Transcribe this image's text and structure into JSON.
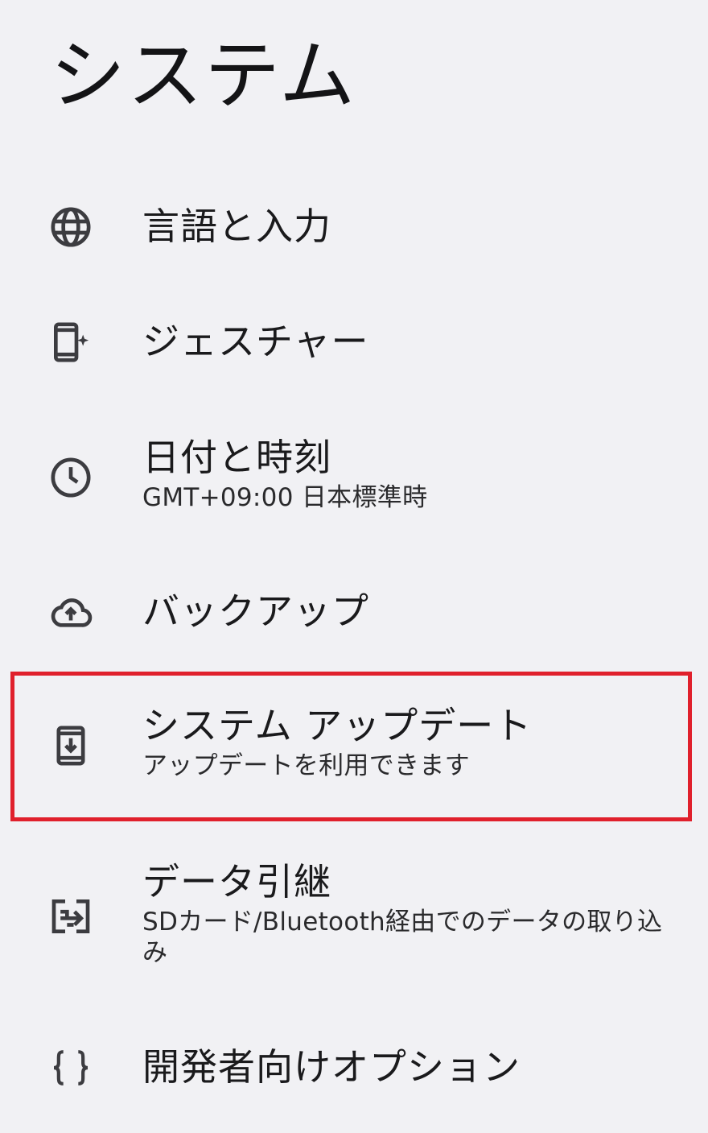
{
  "header": {
    "title": "システム"
  },
  "items": [
    {
      "id": "language",
      "title": "言語と入力",
      "summary": "",
      "icon": "globe-icon"
    },
    {
      "id": "gestures",
      "title": "ジェスチャー",
      "summary": "",
      "icon": "gesture-phone-icon"
    },
    {
      "id": "datetime",
      "title": "日付と時刻",
      "summary": "GMT+09:00 日本標準時",
      "icon": "clock-icon"
    },
    {
      "id": "backup",
      "title": "バックアップ",
      "summary": "",
      "icon": "cloud-upload-icon"
    },
    {
      "id": "system-update",
      "title": "システム アップデート",
      "summary": "アップデートを利用できます",
      "icon": "system-update-icon"
    },
    {
      "id": "data-transfer",
      "title": "データ引継",
      "summary": "SDカード/Bluetooth経由でのデータの取り込み",
      "icon": "data-transfer-icon"
    },
    {
      "id": "developer-options",
      "title": "開発者向けオプション",
      "summary": "",
      "icon": "braces-icon"
    }
  ],
  "annotation": {
    "highlight_color": "#e0202c",
    "highlighted_item": "system-update"
  },
  "colors": {
    "background": "#f1f1f4",
    "text": "#1a1a1c",
    "icon": "#3c3c40"
  }
}
